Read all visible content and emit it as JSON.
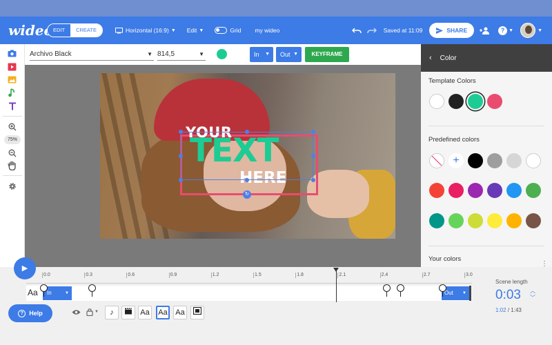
{
  "topbar": {
    "logo": "wideo",
    "mode_edit": "EDIT",
    "mode_create": "CREATE",
    "format": "Horizontal (16:9)",
    "edit_menu": "Edit",
    "grid_label": "Grid",
    "project_name": "my wideo",
    "saved_status": "Saved at 11:09",
    "share_label": "SHARE",
    "help_icon": "?"
  },
  "toolbar": {
    "font": "Archivo Black",
    "size": "814,5",
    "text_color": "#1dcc94",
    "in_label": "In",
    "out_label": "Out",
    "keyframe_label": "KEYFRAME"
  },
  "leftcol": {
    "zoom": "75%"
  },
  "canvas": {
    "line1": "YOUR",
    "line2": "TEXT",
    "line3": "HERE"
  },
  "color_panel": {
    "title": "Color",
    "template_title": "Template Colors",
    "template_colors": [
      "#ffffff",
      "#222222",
      "#1dcc94",
      "#e94c6f"
    ],
    "predefined_title": "Predefined colors",
    "predefined_row1": [
      "none",
      "add",
      "#000000",
      "#9e9e9e",
      "#d6d6d6",
      "#ffffff"
    ],
    "predefined_row2": [
      "#f44336",
      "#e91e63",
      "#9c27b0",
      "#673ab7",
      "#2196f3",
      "#4caf50"
    ],
    "predefined_row3": [
      "#009688",
      "#66d45a",
      "#cddc39",
      "#ffeb3b",
      "#ffb300",
      "#795548"
    ],
    "your_colors_title": "Your colors"
  },
  "timeline": {
    "ticks": [
      "0.0",
      "0.3",
      "0.6",
      "0.9",
      "1.2",
      "1.5",
      "1.8",
      "2.1",
      "2.4",
      "2.7",
      "3.0"
    ],
    "track_label": "Aa",
    "in_chip": "In",
    "out_chip": "Out",
    "help_label": "Help",
    "layer_buttons": [
      "♪",
      "clapper",
      "Aa",
      "Aa",
      "Aa",
      "image"
    ],
    "scene_length_label": "Scene length",
    "scene_length": "0:03",
    "current_time": "1:02",
    "total_time": "1:43",
    "time_separator": "/"
  }
}
